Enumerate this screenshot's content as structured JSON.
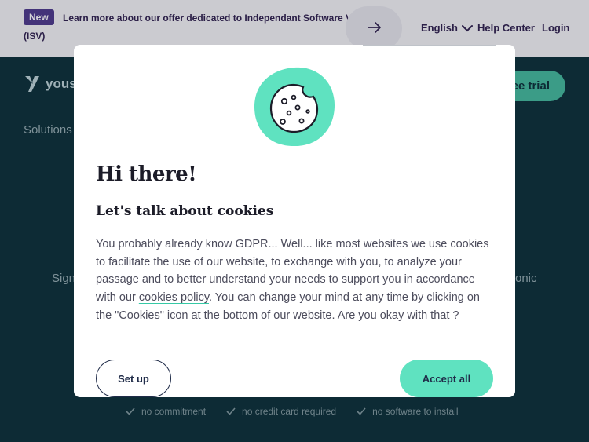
{
  "banner": {
    "badge": "New",
    "text": "Learn more about our offer dedicated to Independant Software Vendors",
    "suffix": "(ISV)",
    "language": "English",
    "help": "Help Center",
    "login": "Login"
  },
  "page": {
    "logo_text": "yous",
    "trial_fragment": "ee trial",
    "solutions": "Solutions",
    "sign_fragment": "Sign",
    "onic_fragment": "onic",
    "features": [
      "no commitment",
      "no credit card required",
      "no software to install"
    ]
  },
  "modal": {
    "title": "Hi there!",
    "subtitle": "Let's talk about cookies",
    "body_before": "You probably already know GDPR... Well... like most websites we use cookies to facilitate the use of our website, to exchange with you, to analyze your passage and to better understand your needs to support you in accordance with our ",
    "policy_link": "cookies policy",
    "body_after": ". You can change your mind at any time by clicking on the \"Cookies\" icon at the bottom of our website. Are you okay with that ?",
    "setup_label": "Set up",
    "accept_label": "Accept all"
  },
  "colors": {
    "accent": "#5fe2c0",
    "badge": "#4d3a8c",
    "dark_bg": "#0d2b35"
  },
  "icons": [
    "arrow-right-icon",
    "chevron-down-icon",
    "cookie-icon",
    "check-icon",
    "logo-icon"
  ]
}
